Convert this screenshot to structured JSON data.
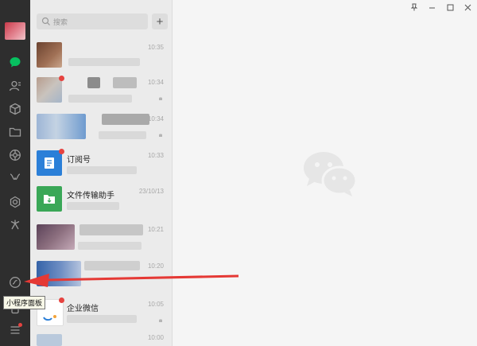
{
  "search": {
    "placeholder": "搜索",
    "add_label": "+"
  },
  "conversations": [
    {
      "title": "",
      "time": "10:35",
      "badge": false
    },
    {
      "title": "",
      "time": "10:34",
      "badge": true
    },
    {
      "title": "",
      "time": "10:34",
      "badge": false
    },
    {
      "title": "订阅号",
      "time": "10:33",
      "badge": true
    },
    {
      "title": "文件传输助手",
      "time": "23/10/13",
      "badge": false
    },
    {
      "title": "",
      "time": "10:21",
      "badge": false
    },
    {
      "title": "",
      "time": "10:20",
      "badge": false
    },
    {
      "title": "企业微信",
      "time": "10:05",
      "badge": true
    },
    {
      "title": "",
      "time": "10:00",
      "badge": false
    }
  ],
  "tooltip": {
    "text": "小程序面板"
  },
  "window_controls": {
    "pin": "pin-icon",
    "minimize": "minimize-icon",
    "maximize": "maximize-icon",
    "close": "close-icon"
  },
  "colors": {
    "sidebar": "#2e2e2e",
    "accent_green": "#07c160",
    "badge_red": "#e64340",
    "arrow_red": "#e53935"
  }
}
